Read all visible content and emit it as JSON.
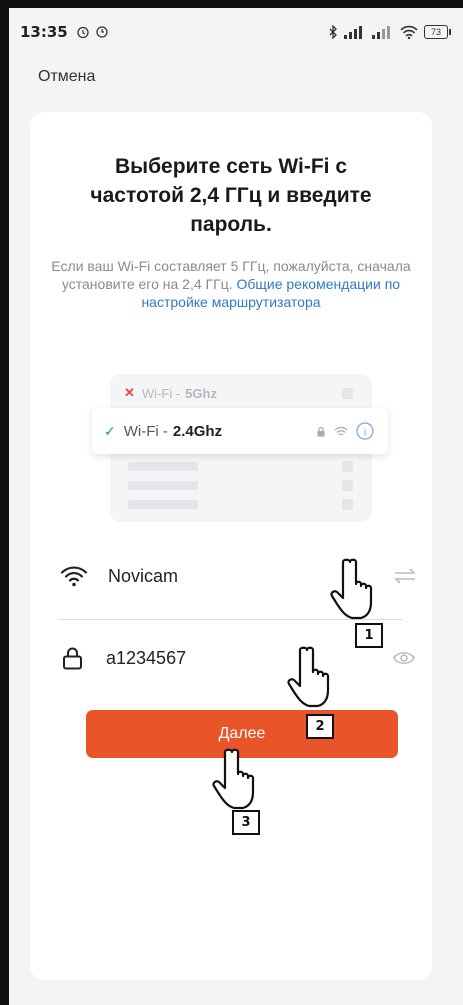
{
  "status_bar": {
    "time": "13:35",
    "battery": "73"
  },
  "header": {
    "cancel_label": "Отмена"
  },
  "main": {
    "title": "Выберите сеть Wi-Fi с частотой 2,4 ГГц и введите пароль.",
    "description_prefix": "Если ваш Wi-Fi составляет 5 ГГц, пожалуйста, сначала установите его на 2,4 ГГц.",
    "description_link": "Общие рекомендации по настройке маршрутизатора",
    "illustration": {
      "row_5ghz_prefix": "Wi-Fi -",
      "row_5ghz_band": "5Ghz",
      "row_24ghz_prefix": "Wi-Fi -",
      "row_24ghz_band": "2.4Ghz"
    },
    "wifi_field": {
      "value": "Novicam"
    },
    "password_field": {
      "value": "a1234567"
    },
    "next_button_label": "Далее"
  },
  "annotations": {
    "steps": [
      "1",
      "2",
      "3"
    ]
  },
  "colors": {
    "accent": "#e95428",
    "link": "#2f79c8",
    "success": "#22a454",
    "error": "#e44444"
  }
}
